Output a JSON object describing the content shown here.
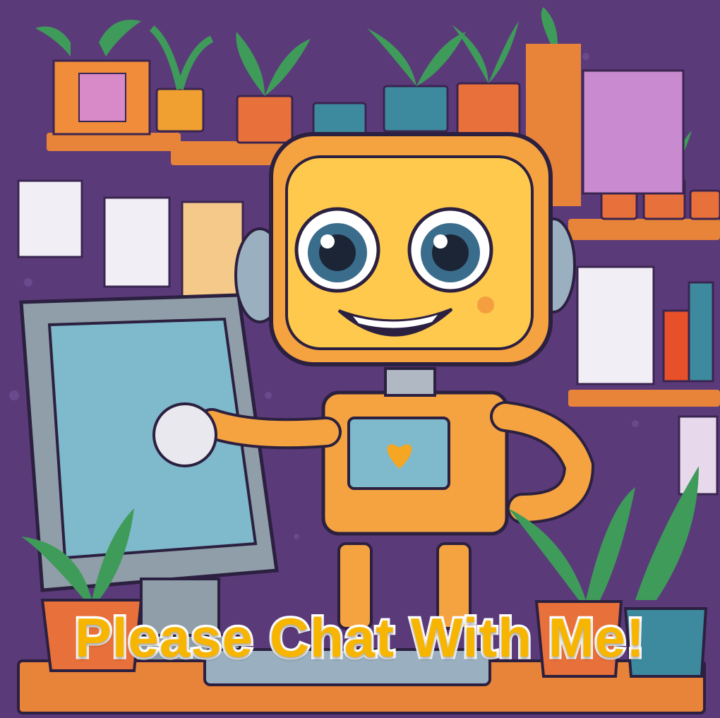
{
  "caption": {
    "text": "Please Chat With Me!",
    "color": "#f7b500",
    "outline_color": "#ffffff"
  },
  "scene": {
    "subject": "robot-icon",
    "palette": {
      "wall": "#5b3a7a",
      "robot_body": "#f4a340",
      "robot_face": "#ffc94d",
      "screen": "#7fb9cc",
      "shelf": "#e8843a",
      "leaf": "#3f9b5a",
      "pot": "#e8703a",
      "heart": "#f5a623"
    }
  }
}
